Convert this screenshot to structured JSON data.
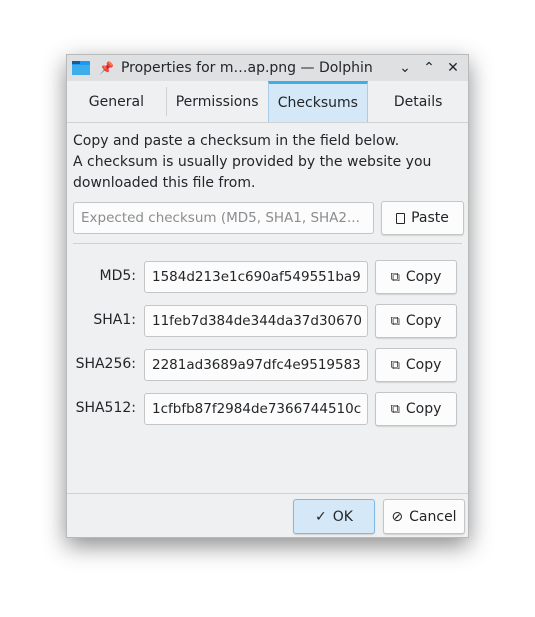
{
  "window": {
    "title": "Properties for m…ap.png — Dolphin",
    "controls": {
      "minimize": "⌄",
      "maximize": "⌃",
      "close": "✕"
    }
  },
  "tabs": [
    {
      "label": "General",
      "active": false
    },
    {
      "label": "Permissions",
      "active": false
    },
    {
      "label": "Checksums",
      "active": true
    },
    {
      "label": "Details",
      "active": false
    }
  ],
  "checksums": {
    "description_line1": "Copy and paste a checksum in the field below.",
    "description_line2": "A checksum is usually provided by the website you",
    "description_line3": "downloaded this file from.",
    "expected_placeholder": "Expected checksum (MD5, SHA1, SHA2...",
    "expected_value": "",
    "paste_label": "Paste",
    "rows": [
      {
        "label": "MD5:",
        "value": "1584d213e1c690af549551ba9",
        "copy_label": "Copy"
      },
      {
        "label": "SHA1:",
        "value": "11feb7d384de344da37d30670",
        "copy_label": "Copy"
      },
      {
        "label": "SHA256:",
        "value": "2281ad3689a97dfc4e9519583",
        "copy_label": "Copy"
      },
      {
        "label": "SHA512:",
        "value": "1cfbfb87f2984de7366744510c",
        "copy_label": "Copy"
      }
    ]
  },
  "footer": {
    "ok_label": "OK",
    "cancel_label": "Cancel"
  },
  "icons": {
    "ok": "✓",
    "cancel": "⃠",
    "copy": "⧉",
    "pin": "✦"
  }
}
